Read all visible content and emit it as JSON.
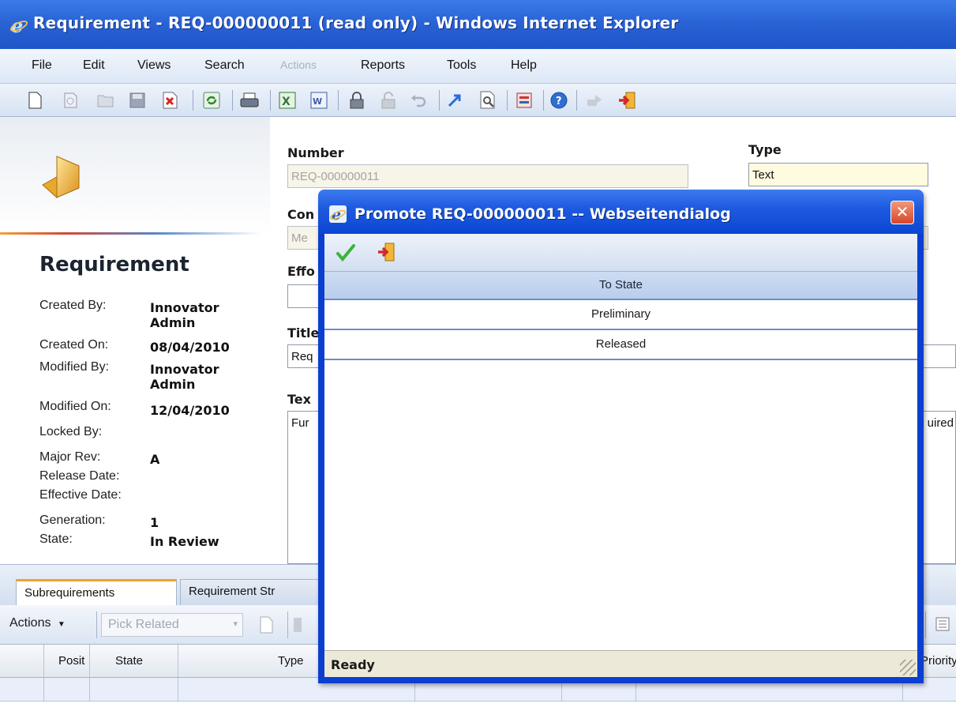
{
  "window": {
    "title": "Requirement - REQ-000000011 (read only) - Windows Internet Explorer"
  },
  "menu": {
    "items": [
      "File",
      "Edit",
      "Views",
      "Search",
      "Actions",
      "Reports",
      "Tools",
      "Help"
    ],
    "disabled": [
      "Actions"
    ]
  },
  "toolbar": {
    "icons": [
      "new-icon",
      "view-icon",
      "open-icon",
      "save-icon",
      "delete-icon",
      "refresh-icon",
      "print-icon",
      "excel-icon",
      "word-icon",
      "lock-icon",
      "unlock-icon",
      "undo-icon",
      "promote-icon",
      "where-used-icon",
      "report-icon",
      "help-icon",
      "claim-icon",
      "exit-icon"
    ]
  },
  "item": {
    "heading": "Requirement",
    "properties": [
      {
        "label": "Created By:",
        "value": "Innovator Admin"
      },
      {
        "label": "Created On:",
        "value": "08/04/2010"
      },
      {
        "label": "Modified By:",
        "value": "Innovator Admin"
      },
      {
        "label": "Modified On:",
        "value": "12/04/2010"
      },
      {
        "label": "Locked By:",
        "value": ""
      },
      {
        "label": "Major Rev:",
        "value": "A"
      },
      {
        "label": "Release Date:",
        "value": ""
      },
      {
        "label": "Effective Date:",
        "value": ""
      },
      {
        "label": "Generation:",
        "value": "1"
      },
      {
        "label": "State:",
        "value": "In Review"
      }
    ]
  },
  "form": {
    "number_label": "Number",
    "number_value": "REQ-000000011",
    "type_label": "Type",
    "type_value": "Text",
    "con_label": "Con",
    "con_value": "Me",
    "effort_label": "Effo",
    "title_label": "Title",
    "title_value": "Req",
    "text_label": "Tex",
    "text_value": "Fur",
    "text_value_right": "uired"
  },
  "tabs": {
    "active": "Subrequirements",
    "inactive": "Requirement Str"
  },
  "relations_bar": {
    "actions_label": "Actions",
    "pick_related": "Pick Related"
  },
  "grid": {
    "columns": [
      "Posit",
      "State",
      "Type",
      "Priority"
    ]
  },
  "dialog": {
    "title": "Promote REQ-000000011 -- Webseitendialog",
    "column_header": "To State",
    "states": [
      "Preliminary",
      "Released"
    ],
    "status": "Ready"
  }
}
